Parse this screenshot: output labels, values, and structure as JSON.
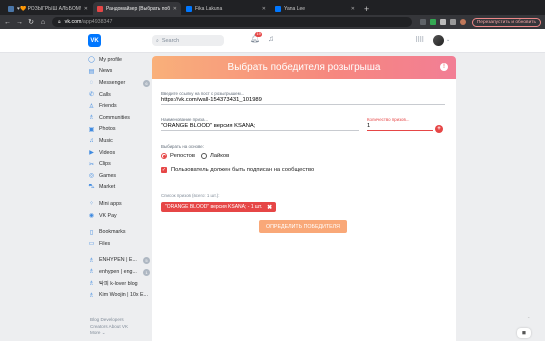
{
  "browser": {
    "tabs": [
      {
        "label": "♥🧡 РОЗЫГРЫШ АЛЬБОМ!!",
        "color": "#4a76a8",
        "active": false
      },
      {
        "label": "Рандомайзер (Выбрать побе",
        "color": "#e64646",
        "active": true
      },
      {
        "label": "Fika Lakuna",
        "color": "#0077ff",
        "active": false
      },
      {
        "label": "Yana Lee",
        "color": "#0077ff",
        "active": false
      }
    ],
    "url_host": "vk.com",
    "url_path": "/app4938347",
    "relaunch_label": "Перезапустить и обновить",
    "back": "←",
    "forward": "→",
    "reload": "↻",
    "home": "⌂"
  },
  "header": {
    "logo": "VK",
    "search_placeholder": "Search",
    "notif_count": "19"
  },
  "sidebar": {
    "items": [
      {
        "label": "My profile",
        "icon": "◯"
      },
      {
        "label": "News",
        "icon": "▤"
      },
      {
        "label": "Messenger",
        "icon": "◌",
        "count": "6"
      },
      {
        "label": "Calls",
        "icon": "✆"
      },
      {
        "label": "Friends",
        "icon": "♙"
      },
      {
        "label": "Communities",
        "icon": "♗"
      },
      {
        "label": "Photos",
        "icon": "▣"
      },
      {
        "label": "Music",
        "icon": "♫"
      },
      {
        "label": "Videos",
        "icon": "▶"
      },
      {
        "label": "Clips",
        "icon": "✂"
      },
      {
        "label": "Games",
        "icon": "◎"
      },
      {
        "label": "Market",
        "icon": "⛍"
      }
    ],
    "items2": [
      {
        "label": "Mini apps",
        "icon": "⁘"
      },
      {
        "label": "VK Pay",
        "icon": "◉"
      }
    ],
    "items3": [
      {
        "label": "Bookmarks",
        "icon": "▯"
      },
      {
        "label": "Files",
        "icon": "▭"
      }
    ],
    "items4": [
      {
        "label": "ENHYPEN | E...",
        "icon": "♗",
        "count": "5"
      },
      {
        "label": "enhypen | eng...",
        "icon": "♗",
        "count": "1"
      },
      {
        "label": "탁피 k-lover blog",
        "icon": "♗"
      },
      {
        "label": "Kim Woojin | 10x E...",
        "icon": "♗"
      }
    ],
    "footer_line1": "Blog  Developers",
    "footer_line2": "Creators  About VK",
    "footer_line3": "More ⌄"
  },
  "app": {
    "title": "Выбрать победителя розыгрыша",
    "post_label": "Введите ссылку на пост с розыгрышем...",
    "post_value": "https://vk.com/wall-154373431_101989",
    "prize_label": "Наименование приза...",
    "prize_value": "\"ORANGE BLOOD\" версия KSANA;",
    "qty_label": "Количество призов...",
    "qty_value": "1",
    "basis_label": "Выбирать на основе:",
    "radio_reposts": "Репостов",
    "radio_likes": "Лайков",
    "subscribed_label": "Пользователь должен быть подписан на сообщество",
    "prize_list_label": "Список призов (всего: 1 шт.):",
    "prize_chip": "\"ORANGE BLOOD\" версия KSANA; - 1 шт.",
    "winner_button": "ОПРЕДЕЛИТЬ ПОБЕДИТЕЛЯ"
  }
}
